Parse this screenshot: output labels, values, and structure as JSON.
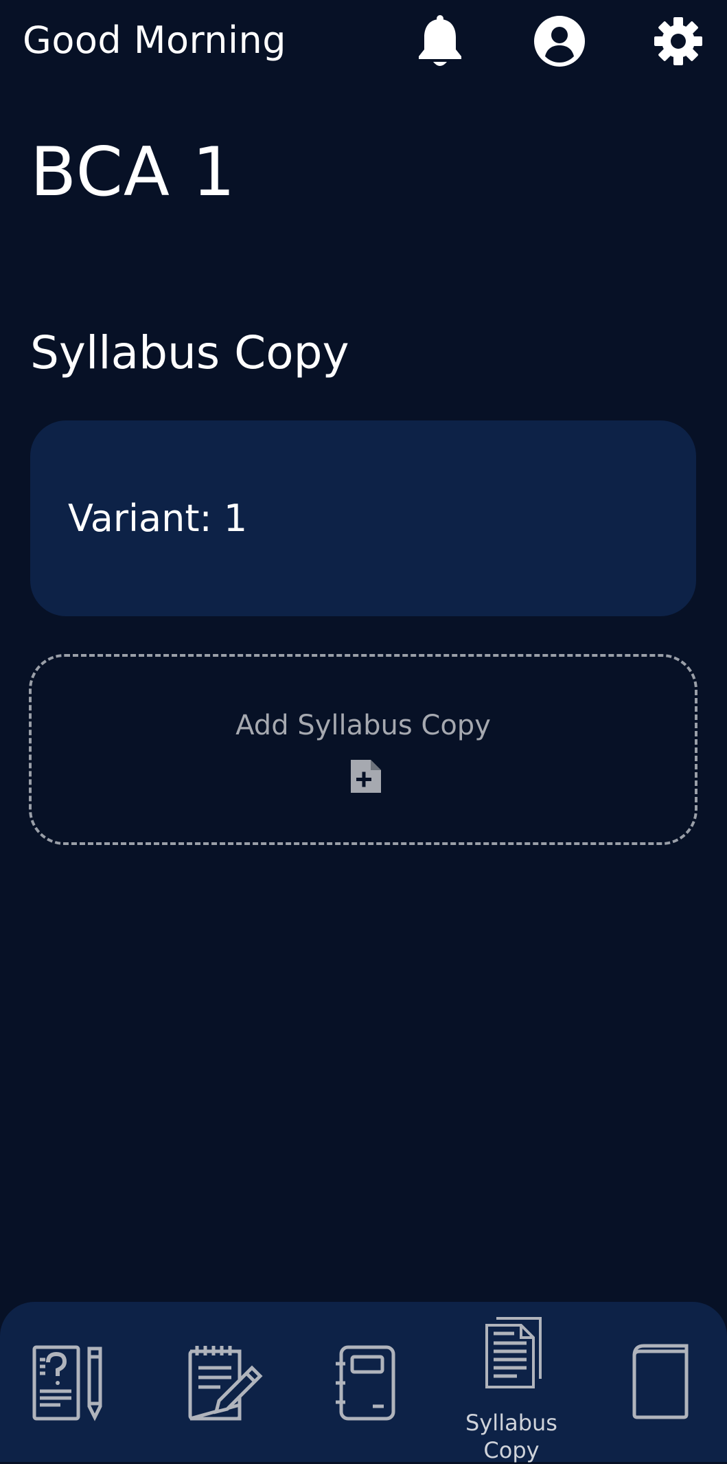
{
  "header": {
    "greeting": "Good Morning",
    "icons": [
      "bell-icon",
      "account-icon",
      "settings-icon"
    ]
  },
  "main": {
    "class_title": "BCA 1",
    "section_title": "Syllabus Copy",
    "variant_card": {
      "label": "Variant: 1"
    },
    "add_card": {
      "label": "Add Syllabus Copy",
      "icon": "file-add-icon"
    }
  },
  "bottom_nav": {
    "items": [
      {
        "icon": "question-paper-icon",
        "label": "",
        "active": false
      },
      {
        "icon": "notes-edit-icon",
        "label": "",
        "active": false
      },
      {
        "icon": "notebook-icon",
        "label": "",
        "active": false
      },
      {
        "icon": "syllabus-document-icon",
        "label": "Syllabus Copy",
        "active": true
      },
      {
        "icon": "book-icon",
        "label": "",
        "active": false
      }
    ]
  },
  "colors": {
    "background": "#071126",
    "card": "#0d2247",
    "text": "#ffffff",
    "muted": "#a6a9b0"
  }
}
